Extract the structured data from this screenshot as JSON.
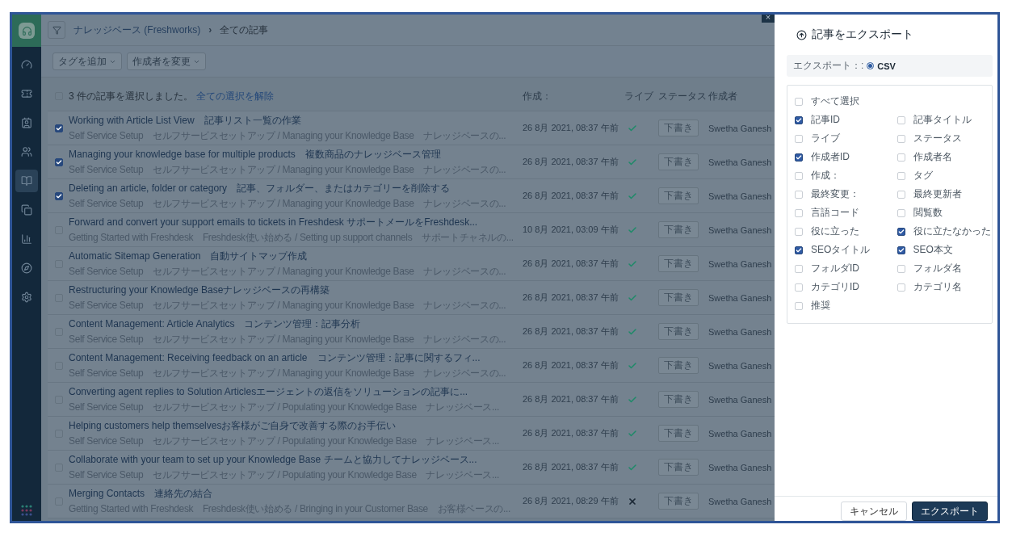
{
  "sidebar": {
    "items": [
      {
        "kind": "dashboard",
        "selected": false
      },
      {
        "kind": "tickets",
        "selected": false
      },
      {
        "kind": "contacts",
        "selected": false
      },
      {
        "kind": "groups",
        "selected": false
      },
      {
        "kind": "knowledge",
        "selected": true
      },
      {
        "kind": "copies",
        "selected": false
      },
      {
        "kind": "reports",
        "selected": false
      },
      {
        "kind": "explore",
        "selected": false
      },
      {
        "kind": "settings",
        "selected": false
      }
    ]
  },
  "header": {
    "breadcrumb_parent": "ナレッジベース (Freshworks)",
    "breadcrumb_separator": "›",
    "breadcrumb_current": "全ての記事",
    "close_label": "×"
  },
  "toolbar": {
    "buttons": [
      "タグを追加",
      "作成者を変更"
    ]
  },
  "table": {
    "selection": {
      "checked": false,
      "text": "3 件の記事を選択しました。",
      "link": "全ての選択を解除"
    },
    "columns": [
      "作成：",
      "ライブ",
      "ステータス",
      "作成者"
    ],
    "rows": [
      {
        "checked": true,
        "title": "Working with Article List View　記事リスト一覧の作業",
        "path": "Self Service Setup　セルフサービスセットアップ / Managing your Knowledge Base　ナレッジベースの...",
        "created": "26 8月 2021, 08:37 午前",
        "live": true,
        "status": "下書き",
        "author": "Swetha Ganesh"
      },
      {
        "checked": true,
        "title": "Managing your knowledge base for multiple products　複数商品のナレッジベース管理",
        "path": "Self Service Setup　セルフサービスセットアップ / Managing your Knowledge Base　ナレッジベースの...",
        "created": "26 8月 2021, 08:37 午前",
        "live": true,
        "status": "下書き",
        "author": "Swetha Ganesh"
      },
      {
        "checked": true,
        "title": "Deleting an article, folder or category　記事、フォルダー、またはカテゴリーを削除する",
        "path": "Self Service Setup　セルフサービスセットアップ / Managing your Knowledge Base　ナレッジベースの...",
        "created": "26 8月 2021, 08:37 午前",
        "live": true,
        "status": "下書き",
        "author": "Swetha Ganesh"
      },
      {
        "checked": false,
        "title": "Forward and convert your support emails to tickets in Freshdesk サポートメールをFreshdesk...",
        "path": "Getting Started with Freshdesk　Freshdesk使い始める / Setting up support channels　サポートチャネルの...",
        "created": "10 8月 2021, 03:09 午前",
        "live": true,
        "status": "下書き",
        "author": "Swetha Ganesh"
      },
      {
        "checked": false,
        "title": "Automatic Sitemap Generation　自動サイトマップ作成",
        "path": "Self Service Setup　セルフサービスセットアップ / Managing your Knowledge Base　ナレッジベースの...",
        "created": "26 8月 2021, 08:37 午前",
        "live": true,
        "status": "下書き",
        "author": "Swetha Ganesh"
      },
      {
        "checked": false,
        "title": "Restructuring your Knowledge Baseナレッジベースの再構築",
        "path": "Self Service Setup　セルフサービスセットアップ / Managing your Knowledge Base　ナレッジベースの...",
        "created": "26 8月 2021, 08:37 午前",
        "live": true,
        "status": "下書き",
        "author": "Swetha Ganesh"
      },
      {
        "checked": false,
        "title": "Content Management: Article Analytics　コンテンツ管理：記事分析",
        "path": "Self Service Setup　セルフサービスセットアップ / Managing your Knowledge Base　ナレッジベースの...",
        "created": "26 8月 2021, 08:37 午前",
        "live": true,
        "status": "下書き",
        "author": "Swetha Ganesh"
      },
      {
        "checked": false,
        "title": "Content Management: Receiving feedback on an article　コンテンツ管理：記事に関するフィ...",
        "path": "Self Service Setup　セルフサービスセットアップ / Managing your Knowledge Base　ナレッジベースの...",
        "created": "26 8月 2021, 08:37 午前",
        "live": true,
        "status": "下書き",
        "author": "Swetha Ganesh"
      },
      {
        "checked": false,
        "title": "Converting agent replies to Solution Articlesエージェントの返信をソリューションの記事に...",
        "path": "Self Service Setup　セルフサービスセットアップ / Populating your Knowledge Base　ナレッジベース...",
        "created": "26 8月 2021, 08:37 午前",
        "live": true,
        "status": "下書き",
        "author": "Swetha Ganesh"
      },
      {
        "checked": false,
        "title": "Helping customers help themselvesお客様がご自身で改善する際のお手伝い",
        "path": "Self Service Setup　セルフサービスセットアップ / Populating your Knowledge Base　ナレッジベース...",
        "created": "26 8月 2021, 08:37 午前",
        "live": true,
        "status": "下書き",
        "author": "Swetha Ganesh"
      },
      {
        "checked": false,
        "title": "Collaborate with your team to set up your Knowledge Base チームと協力してナレッジベース...",
        "path": "Self Service Setup　セルフサービスセットアップ / Populating your Knowledge Base　ナレッジベース...",
        "created": "26 8月 2021, 08:37 午前",
        "live": true,
        "status": "下書き",
        "author": "Swetha Ganesh"
      },
      {
        "checked": false,
        "title": "Merging Contacts　連絡先の結合",
        "path": "Getting Started with Freshdesk　Freshdesk使い始める / Bringing in your Customer Base　お客様ベースの...",
        "created": "26 8月 2021, 08:29 午前",
        "live": false,
        "status": "下書き",
        "author": "Swetha Ganesh"
      }
    ]
  },
  "export_panel": {
    "title": "記事をエクスポート",
    "format_label": "エクスポート：:",
    "formats": [
      {
        "label": "CSV",
        "selected": true
      }
    ],
    "select_all": {
      "label": "すべて選択",
      "checked": false
    },
    "fields": [
      {
        "label": "記事ID",
        "checked": true
      },
      {
        "label": "記事タイトル",
        "checked": false
      },
      {
        "label": "ライブ",
        "checked": false
      },
      {
        "label": "ステータス",
        "checked": false
      },
      {
        "label": "作成者ID",
        "checked": true
      },
      {
        "label": "作成者名",
        "checked": false
      },
      {
        "label": "作成：",
        "checked": false
      },
      {
        "label": "タグ",
        "checked": false
      },
      {
        "label": "最終変更：",
        "checked": false
      },
      {
        "label": "最終更新者",
        "checked": false
      },
      {
        "label": "言語コード",
        "checked": false
      },
      {
        "label": "閲覧数",
        "checked": false
      },
      {
        "label": "役に立った",
        "checked": false
      },
      {
        "label": "役に立たなかった",
        "checked": true
      },
      {
        "label": "SEOタイトル",
        "checked": true
      },
      {
        "label": "SEO本文",
        "checked": true
      },
      {
        "label": "フォルダID",
        "checked": false
      },
      {
        "label": "フォルダ名",
        "checked": false
      },
      {
        "label": "カテゴリID",
        "checked": false
      },
      {
        "label": "カテゴリ名",
        "checked": false
      },
      {
        "label": "推奨",
        "checked": false
      }
    ],
    "buttons": [
      {
        "label": "キャンセル",
        "kind": "secondary"
      },
      {
        "label": "エクスポート",
        "kind": "primary"
      }
    ]
  }
}
